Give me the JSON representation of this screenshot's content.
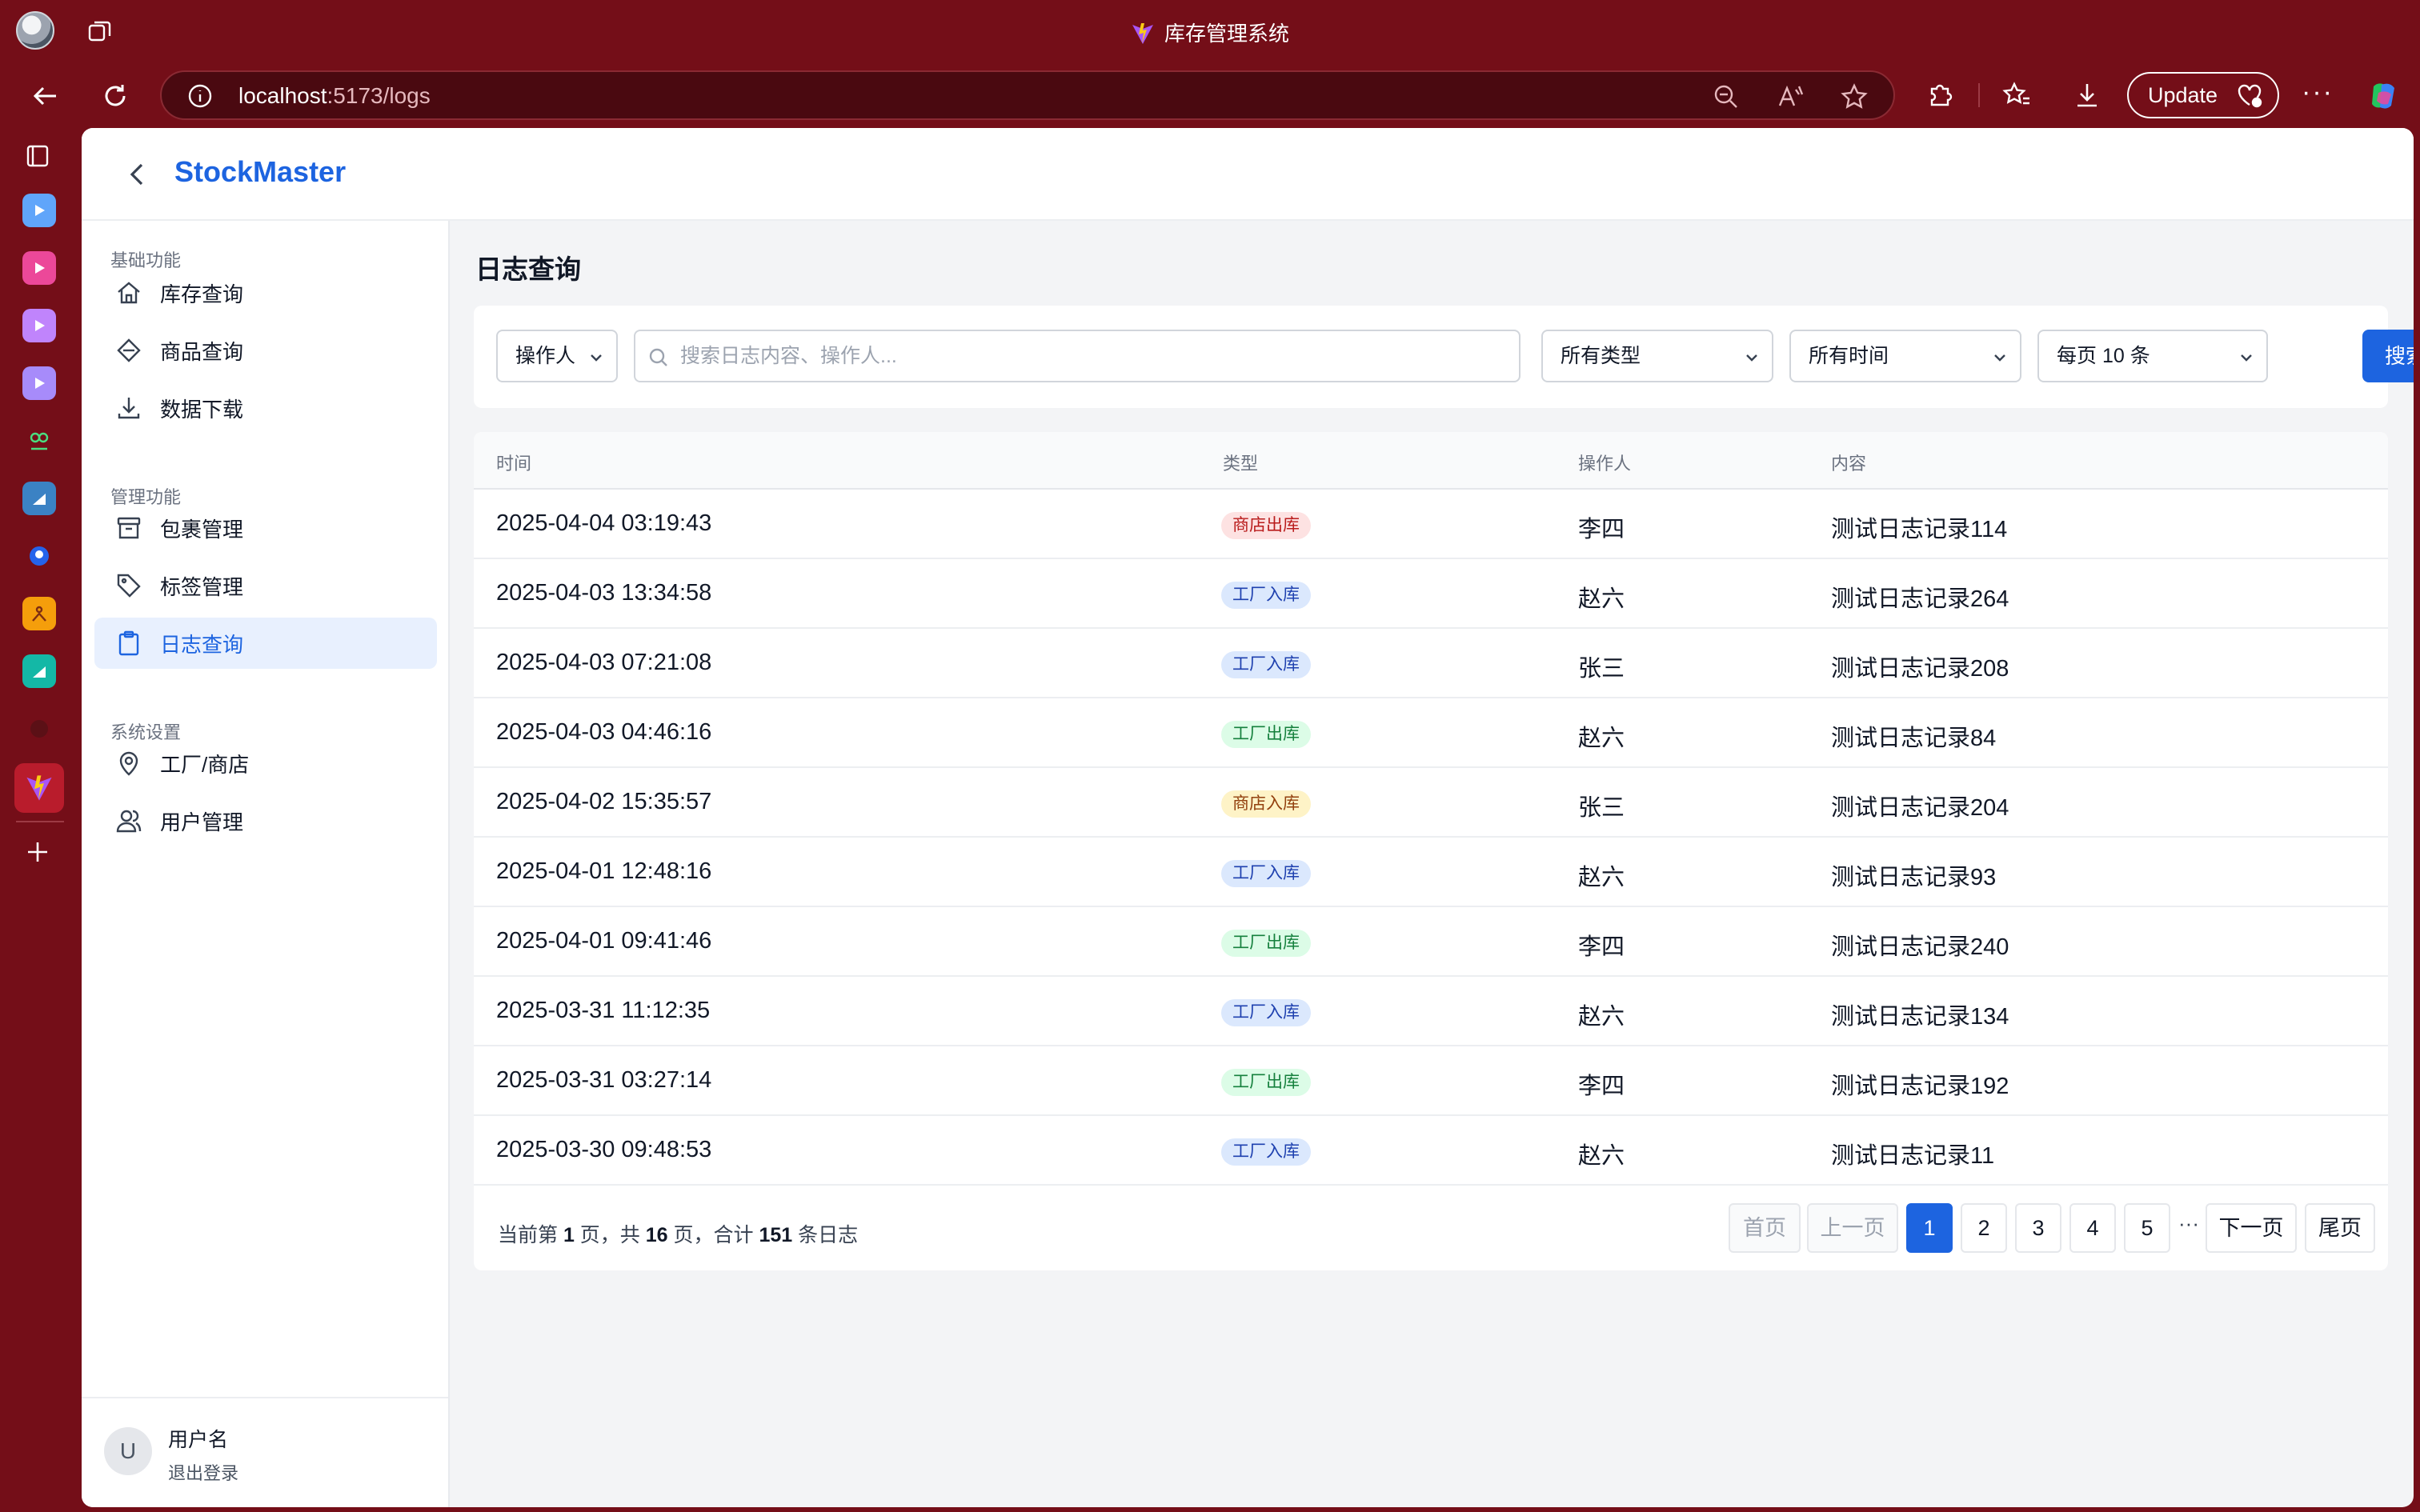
{
  "browser": {
    "window_title": "库存管理系统",
    "url_host": "localhost",
    "url_path": ":5173/logs",
    "update_label": "Update",
    "more_label": "···"
  },
  "app": {
    "brand": "StockMaster",
    "page_title": "日志查询",
    "sidebar": {
      "groups": [
        {
          "label": "基础功能"
        },
        {
          "label": "管理功能"
        },
        {
          "label": "系统设置"
        }
      ],
      "items": [
        {
          "label": "库存查询",
          "icon": "home-icon"
        },
        {
          "label": "商品查询",
          "icon": "tag-diamond-icon"
        },
        {
          "label": "数据下载",
          "icon": "download-icon"
        },
        {
          "label": "包裹管理",
          "icon": "archive-box-icon"
        },
        {
          "label": "标签管理",
          "icon": "tag-icon"
        },
        {
          "label": "日志查询",
          "icon": "clipboard-icon",
          "active": true
        },
        {
          "label": "工厂/商店",
          "icon": "map-pin-icon"
        },
        {
          "label": "用户管理",
          "icon": "users-icon"
        }
      ],
      "user": {
        "avatar": "U",
        "name": "用户名",
        "logout": "退出登录"
      }
    },
    "filters": {
      "field_select": "操作人",
      "search_placeholder": "搜索日志内容、操作人...",
      "type_select": "所有类型",
      "time_select": "所有时间",
      "page_size_select": "每页 10 条",
      "search_button": "搜索"
    },
    "table": {
      "headers": [
        "时间",
        "类型",
        "操作人",
        "内容"
      ],
      "rows": [
        {
          "time": "2025-04-04 03:19:43",
          "type": "商店出库",
          "operator": "李四",
          "content": "测试日志记录114"
        },
        {
          "time": "2025-04-03 13:34:58",
          "type": "工厂入库",
          "operator": "赵六",
          "content": "测试日志记录264"
        },
        {
          "time": "2025-04-03 07:21:08",
          "type": "工厂入库",
          "operator": "张三",
          "content": "测试日志记录208"
        },
        {
          "time": "2025-04-03 04:46:16",
          "type": "工厂出库",
          "operator": "赵六",
          "content": "测试日志记录84"
        },
        {
          "time": "2025-04-02 15:35:57",
          "type": "商店入库",
          "operator": "张三",
          "content": "测试日志记录204"
        },
        {
          "time": "2025-04-01 12:48:16",
          "type": "工厂入库",
          "operator": "赵六",
          "content": "测试日志记录93"
        },
        {
          "time": "2025-04-01 09:41:46",
          "type": "工厂出库",
          "operator": "李四",
          "content": "测试日志记录240"
        },
        {
          "time": "2025-03-31 11:12:35",
          "type": "工厂入库",
          "operator": "赵六",
          "content": "测试日志记录134"
        },
        {
          "time": "2025-03-31 03:27:14",
          "type": "工厂出库",
          "operator": "李四",
          "content": "测试日志记录192"
        },
        {
          "time": "2025-03-30 09:48:53",
          "type": "工厂入库",
          "operator": "赵六",
          "content": "测试日志记录11"
        }
      ]
    },
    "pagination": {
      "text_prefix": "当前第 ",
      "current_page": "1",
      "text_mid1": " 页，共 ",
      "total_pages": "16",
      "text_mid2": " 页，合计 ",
      "total_count": "151",
      "text_suffix": " 条日志",
      "first": "首页",
      "prev": "上一页",
      "pages": [
        "1",
        "2",
        "3",
        "4",
        "5"
      ],
      "ellipsis": "···",
      "next": "下一页",
      "last": "尾页"
    }
  },
  "colors": {
    "browser_frame": "#740e18",
    "accent": "#1d64e0",
    "badge_shop_out": "#b91c1c",
    "badge_factory_in": "#1e40af",
    "badge_factory_out": "#15803d",
    "badge_shop_in": "#92400e"
  }
}
